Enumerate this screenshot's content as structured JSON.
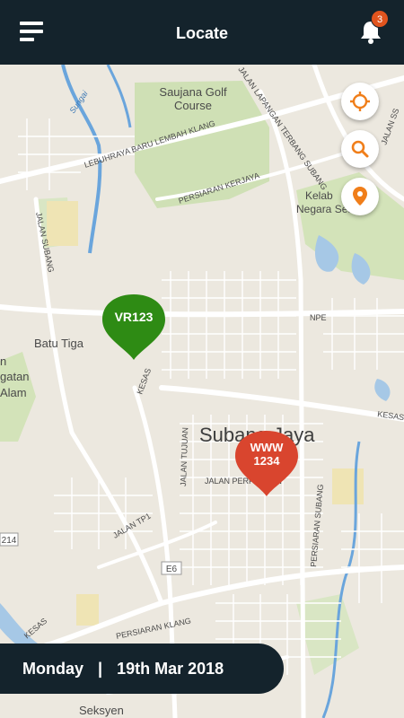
{
  "header": {
    "title": "Locate",
    "notification_count": "3"
  },
  "map": {
    "labels": {
      "saujana_golf": "Saujana Golf",
      "course": "Course",
      "lebuhraya": "LEBUHRAYA BARU LEMBAH KLANG",
      "persiaran_kerjaya": "PERSIARAN KERJAYA",
      "jalan_lapangan": "JALAN LAPANGAN TERBANG SUBANG",
      "jalan_subang_left": "JALAN SUBANG",
      "jalan_ss": "JALAN SS",
      "kelab": "Kelab",
      "negara_sea": "Negara Sea",
      "sungai": "Sungai",
      "batu_tiga": "Batu Tiga",
      "npe": "NPE",
      "kesas_mid": "KESAS",
      "kesas_right": "KESAS",
      "kesas_bottom": "KESAS",
      "subang_jaya": "Subang Jaya",
      "jalan_tujuan": "JALAN TUJUAN",
      "jalan_perpaduan": "JALAN PERPADUAN",
      "persiaran_subang": "PERSIARAN SUBANG",
      "jalan_tp1": "JALAN TP1",
      "e6": "E6",
      "route_214": "214",
      "persiaran_klang": "PERSIARAN KLANG",
      "seksyen": "Seksyen",
      "n": "n",
      "gatan": "gatan",
      "alam": "Alam"
    }
  },
  "controls": {
    "locate_icon": "crosshair-icon",
    "search_icon": "search-icon",
    "pin_icon": "map-pin-icon",
    "accent": "#f07e1a"
  },
  "vehicles": [
    {
      "label": "VR123",
      "color": "#2e8b14"
    },
    {
      "label": "WWW 1234",
      "color": "#d9452e"
    }
  ],
  "date_bar": {
    "day": "Monday",
    "separator": "|",
    "date": "19th Mar 2018"
  }
}
